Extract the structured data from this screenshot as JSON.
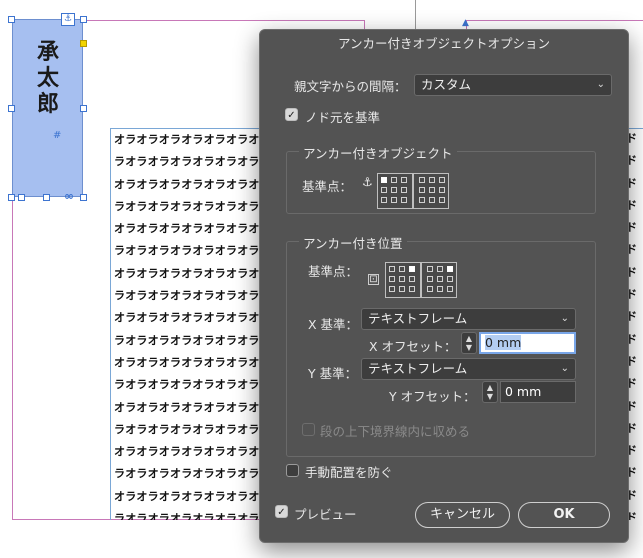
{
  "document": {
    "anchored_text": [
      "承",
      "太",
      "郎"
    ],
    "body_line": "オラオラオラオラオラオラオラオラオラオラオラオラオラオラオラオラオラオラ",
    "body_line_alt": "ラオラオラオラオラオラオラオラオラオラオラオラオラオラオラオラオラオラオ",
    "line_count": 18,
    "right_frame_char": "ド",
    "anchor_glyph": "⚓",
    "hash_glyph": "#",
    "oo_glyph": "∞"
  },
  "dialog": {
    "title": "アンカー付きオブジェクトオプション",
    "parent_spacing": {
      "label": "親文字からの間隔：",
      "value": "カスタム"
    },
    "relative_to_spine": {
      "label": "ノド元を基準",
      "checked": true
    },
    "anchored_object": {
      "group_title": "アンカー付きオブジェクト",
      "reference_label": "基準点："
    },
    "anchored_position": {
      "group_title": "アンカー付き位置",
      "reference_label": "基準点：",
      "x_relative_label": "X 基準：",
      "x_relative_value": "テキストフレーム",
      "x_offset_label": "X オフセット：",
      "x_offset_value": "0 mm",
      "y_relative_label": "Y 基準：",
      "y_relative_value": "テキストフレーム",
      "y_offset_label": "Y オフセット：",
      "y_offset_value": "0 mm",
      "keep_within_label": "段の上下境界線内に収める",
      "keep_within_checked": false
    },
    "prevent_manual": {
      "label": "手動配置を防ぐ",
      "checked": false
    },
    "preview": {
      "label": "プレビュー",
      "checked": true
    },
    "buttons": {
      "cancel": "キャンセル",
      "ok": "OK"
    }
  }
}
